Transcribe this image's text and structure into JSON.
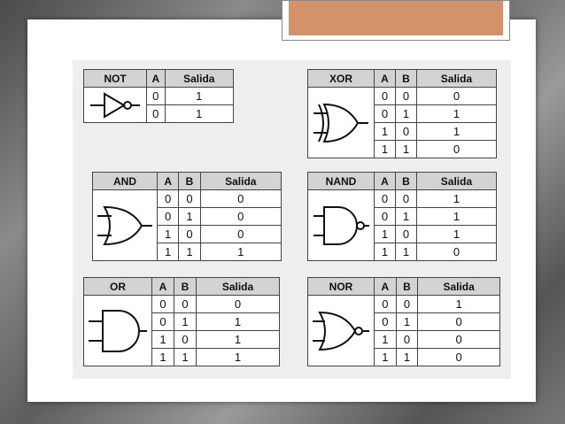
{
  "tables": {
    "not": {
      "header": [
        "NOT",
        "A",
        "Salida"
      ],
      "rows": [
        [
          "0",
          "1"
        ],
        [
          "0",
          "1"
        ]
      ]
    },
    "xor": {
      "header": [
        "XOR",
        "A",
        "B",
        "Salida"
      ],
      "rows": [
        [
          "0",
          "0",
          "0"
        ],
        [
          "0",
          "1",
          "1"
        ],
        [
          "1",
          "0",
          "1"
        ],
        [
          "1",
          "1",
          "0"
        ]
      ]
    },
    "and": {
      "header": [
        "AND",
        "A",
        "B",
        "Salida"
      ],
      "rows": [
        [
          "0",
          "0",
          "0"
        ],
        [
          "0",
          "1",
          "0"
        ],
        [
          "1",
          "0",
          "0"
        ],
        [
          "1",
          "1",
          "1"
        ]
      ]
    },
    "nand": {
      "header": [
        "NAND",
        "A",
        "B",
        "Salida"
      ],
      "rows": [
        [
          "0",
          "0",
          "1"
        ],
        [
          "0",
          "1",
          "1"
        ],
        [
          "1",
          "0",
          "1"
        ],
        [
          "1",
          "1",
          "0"
        ]
      ]
    },
    "or": {
      "header": [
        "OR",
        "A",
        "B",
        "Salida"
      ],
      "rows": [
        [
          "0",
          "0",
          "0"
        ],
        [
          "0",
          "1",
          "1"
        ],
        [
          "1",
          "0",
          "1"
        ],
        [
          "1",
          "1",
          "1"
        ]
      ]
    },
    "nor": {
      "header": [
        "NOR",
        "A",
        "B",
        "Salida"
      ],
      "rows": [
        [
          "0",
          "0",
          "1"
        ],
        [
          "0",
          "1",
          "0"
        ],
        [
          "1",
          "0",
          "0"
        ],
        [
          "1",
          "1",
          "0"
        ]
      ]
    }
  },
  "colors": {
    "title_fill": "#d4926a",
    "header_bg": "#d3d3d3"
  }
}
